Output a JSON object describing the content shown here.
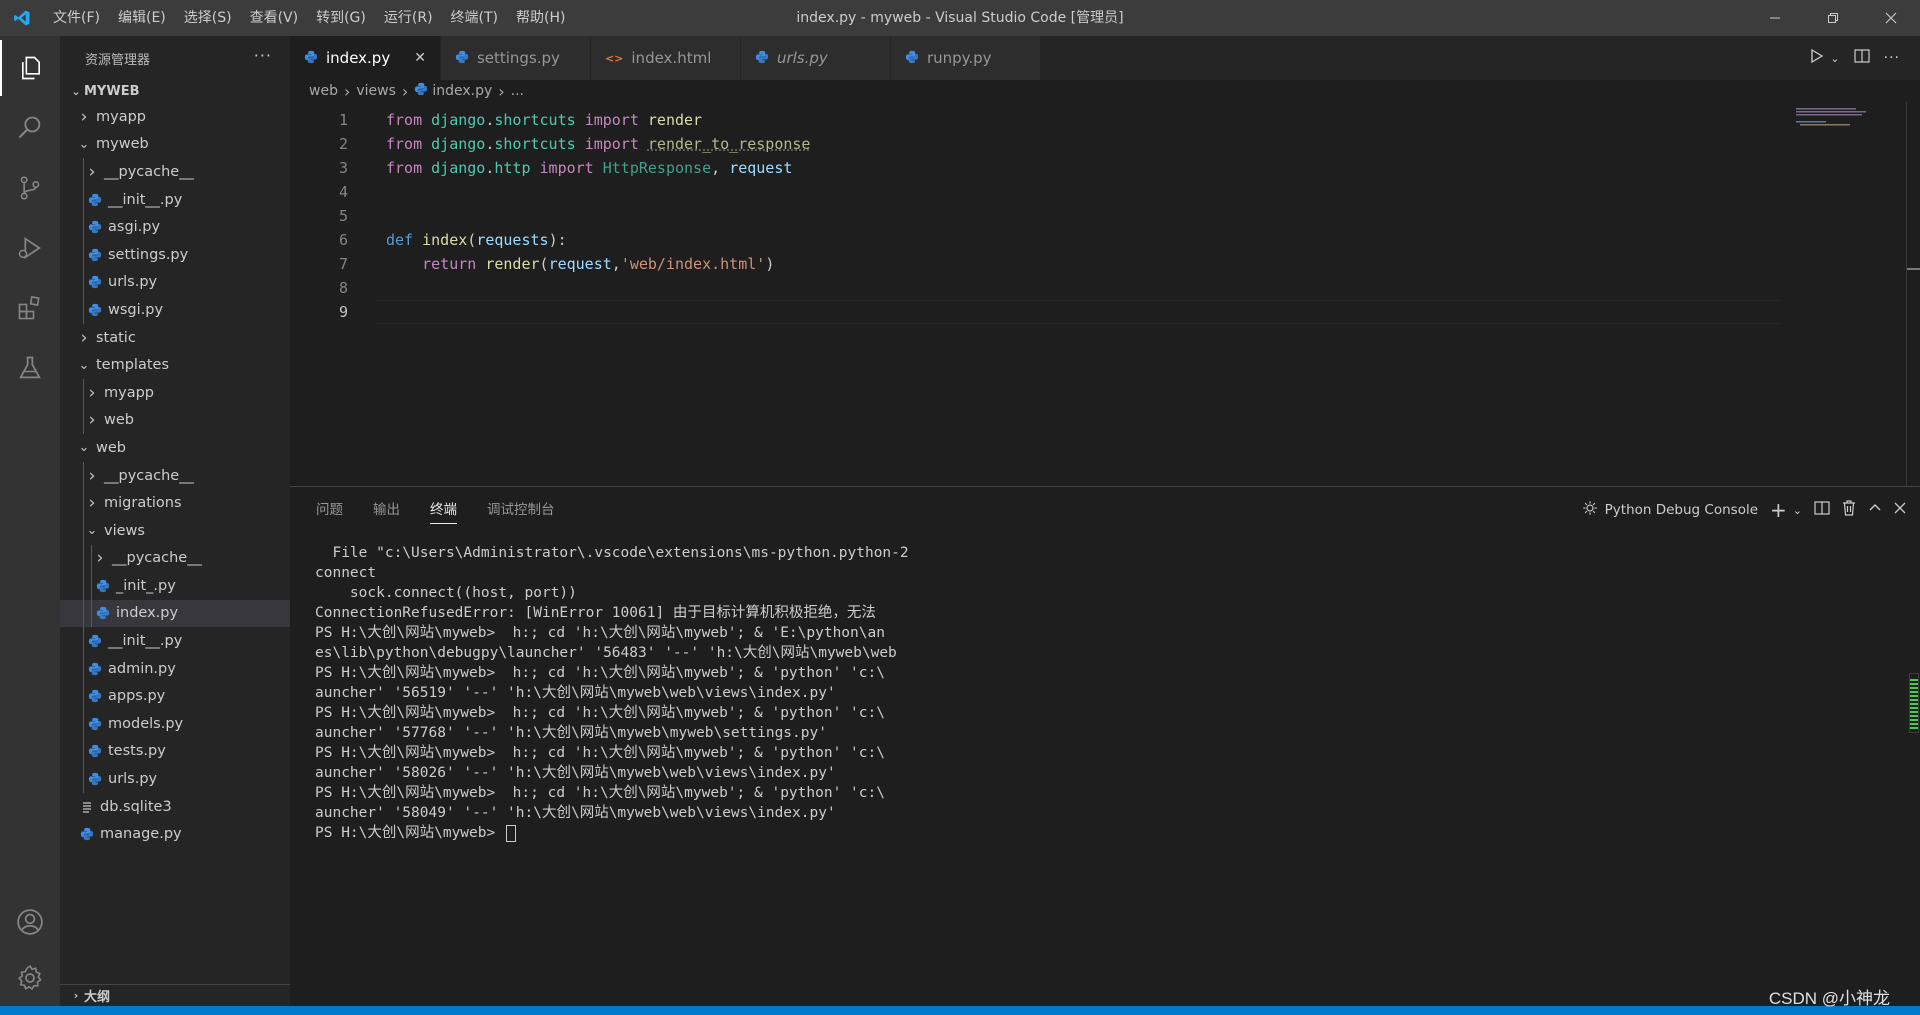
{
  "window": {
    "title": "index.py - myweb - Visual Studio Code [管理员]"
  },
  "menu": [
    "文件(F)",
    "编辑(E)",
    "选择(S)",
    "查看(V)",
    "转到(G)",
    "运行(R)",
    "终端(T)",
    "帮助(H)"
  ],
  "sidebar": {
    "title": "资源管理器",
    "more": "···",
    "root": "MYWEB",
    "outline": "大纲",
    "tree": [
      {
        "label": "myapp",
        "depth": 1,
        "kind": "folder",
        "open": false
      },
      {
        "label": "myweb",
        "depth": 1,
        "kind": "folder",
        "open": true
      },
      {
        "label": "__pycache__",
        "depth": 2,
        "kind": "folder",
        "open": false
      },
      {
        "label": "__init__.py",
        "depth": 2,
        "kind": "py"
      },
      {
        "label": "asgi.py",
        "depth": 2,
        "kind": "py"
      },
      {
        "label": "settings.py",
        "depth": 2,
        "kind": "py"
      },
      {
        "label": "urls.py",
        "depth": 2,
        "kind": "py"
      },
      {
        "label": "wsgi.py",
        "depth": 2,
        "kind": "py"
      },
      {
        "label": "static",
        "depth": 1,
        "kind": "folder",
        "open": false
      },
      {
        "label": "templates",
        "depth": 1,
        "kind": "folder",
        "open": true
      },
      {
        "label": "myapp",
        "depth": 2,
        "kind": "folder",
        "open": false
      },
      {
        "label": "web",
        "depth": 2,
        "kind": "folder",
        "open": false
      },
      {
        "label": "web",
        "depth": 1,
        "kind": "folder",
        "open": true
      },
      {
        "label": "__pycache__",
        "depth": 2,
        "kind": "folder",
        "open": false
      },
      {
        "label": "migrations",
        "depth": 2,
        "kind": "folder",
        "open": false
      },
      {
        "label": "views",
        "depth": 2,
        "kind": "folder",
        "open": true
      },
      {
        "label": "__pycache__",
        "depth": 3,
        "kind": "folder",
        "open": false
      },
      {
        "label": "_init_.py",
        "depth": 3,
        "kind": "py"
      },
      {
        "label": "index.py",
        "depth": 3,
        "kind": "py",
        "selected": true
      },
      {
        "label": "__init__.py",
        "depth": 2,
        "kind": "py"
      },
      {
        "label": "admin.py",
        "depth": 2,
        "kind": "py"
      },
      {
        "label": "apps.py",
        "depth": 2,
        "kind": "py"
      },
      {
        "label": "models.py",
        "depth": 2,
        "kind": "py"
      },
      {
        "label": "tests.py",
        "depth": 2,
        "kind": "py"
      },
      {
        "label": "urls.py",
        "depth": 2,
        "kind": "py"
      },
      {
        "label": "db.sqlite3",
        "depth": 1,
        "kind": "db"
      },
      {
        "label": "manage.py",
        "depth": 1,
        "kind": "py"
      }
    ]
  },
  "tabs": [
    {
      "label": "index.py",
      "icon": "python",
      "active": true,
      "italic": false
    },
    {
      "label": "settings.py",
      "icon": "python",
      "active": false,
      "italic": false
    },
    {
      "label": "index.html",
      "icon": "html",
      "active": false,
      "italic": false
    },
    {
      "label": "urls.py",
      "icon": "python",
      "active": false,
      "italic": true
    },
    {
      "label": "runpy.py",
      "icon": "python",
      "active": false,
      "italic": false
    }
  ],
  "breadcrumb": [
    "web",
    "views",
    "index.py",
    "..."
  ],
  "code": {
    "current_line": 9,
    "lines": [
      [
        [
          "kw",
          "from"
        ],
        [
          "t",
          " "
        ],
        [
          "mod",
          "django"
        ],
        [
          "t",
          "."
        ],
        [
          "mod",
          "shortcuts"
        ],
        [
          "t",
          " "
        ],
        [
          "kw",
          "import"
        ],
        [
          "t",
          " "
        ],
        [
          "fn",
          "render"
        ]
      ],
      [
        [
          "kw",
          "from"
        ],
        [
          "t",
          " "
        ],
        [
          "mod",
          "django"
        ],
        [
          "t",
          "."
        ],
        [
          "mod",
          "shortcuts"
        ],
        [
          "t",
          " "
        ],
        [
          "kw",
          "import"
        ],
        [
          "t",
          " "
        ],
        [
          "dimfn",
          "render_to_response"
        ]
      ],
      [
        [
          "kw",
          "from"
        ],
        [
          "t",
          " "
        ],
        [
          "mod",
          "django"
        ],
        [
          "t",
          "."
        ],
        [
          "mod",
          "http"
        ],
        [
          "t",
          " "
        ],
        [
          "kw",
          "import"
        ],
        [
          "t",
          " "
        ],
        [
          "dim",
          "HttpResponse"
        ],
        [
          "t",
          ", "
        ],
        [
          "var",
          "request"
        ]
      ],
      [],
      [],
      [
        [
          "def",
          "def"
        ],
        [
          "t",
          " "
        ],
        [
          "fn",
          "index"
        ],
        [
          "t",
          "("
        ],
        [
          "var",
          "requests"
        ],
        [
          "t",
          "):"
        ]
      ],
      [
        [
          "t",
          "    "
        ],
        [
          "kw",
          "return"
        ],
        [
          "t",
          " "
        ],
        [
          "fn",
          "render"
        ],
        [
          "t",
          "("
        ],
        [
          "var",
          "request"
        ],
        [
          "t",
          ","
        ],
        [
          "str",
          "'web/index.html'"
        ],
        [
          "t",
          ")"
        ]
      ],
      [],
      []
    ]
  },
  "panel": {
    "tabs": [
      "问题",
      "输出",
      "终端",
      "调试控制台"
    ],
    "active_tab": 2,
    "console": "Python Debug Console",
    "terminal": [
      "  File \"c:\\Users\\Administrator\\.vscode\\extensions\\ms-python.python-2",
      "connect",
      "    sock.connect((host, port))",
      "ConnectionRefusedError: [WinError 10061] 由于目标计算机积极拒绝，无法",
      "PS H:\\大创\\网站\\myweb>  h:; cd 'h:\\大创\\网站\\myweb'; & 'E:\\python\\an",
      "es\\lib\\python\\debugpy\\launcher' '56483' '--' 'h:\\大创\\网站\\myweb\\web",
      "PS H:\\大创\\网站\\myweb>  h:; cd 'h:\\大创\\网站\\myweb'; & 'python' 'c:\\",
      "auncher' '56519' '--' 'h:\\大创\\网站\\myweb\\web\\views\\index.py'",
      "PS H:\\大创\\网站\\myweb>  h:; cd 'h:\\大创\\网站\\myweb'; & 'python' 'c:\\",
      "auncher' '57768' '--' 'h:\\大创\\网站\\myweb\\myweb\\settings.py'",
      "PS H:\\大创\\网站\\myweb>  h:; cd 'h:\\大创\\网站\\myweb'; & 'python' 'c:\\",
      "auncher' '58026' '--' 'h:\\大创\\网站\\myweb\\web\\views\\index.py'",
      "PS H:\\大创\\网站\\myweb>  h:; cd 'h:\\大创\\网站\\myweb'; & 'python' 'c:\\",
      "auncher' '58049' '--' 'h:\\大创\\网站\\myweb\\web\\views\\index.py'"
    ],
    "prompt": "PS H:\\大创\\网站\\myweb> "
  },
  "watermark": "CSDN @小神龙",
  "colors": {
    "accent": "#007acc",
    "python_icon": "#3b8eea",
    "html_icon": "#e37933"
  }
}
